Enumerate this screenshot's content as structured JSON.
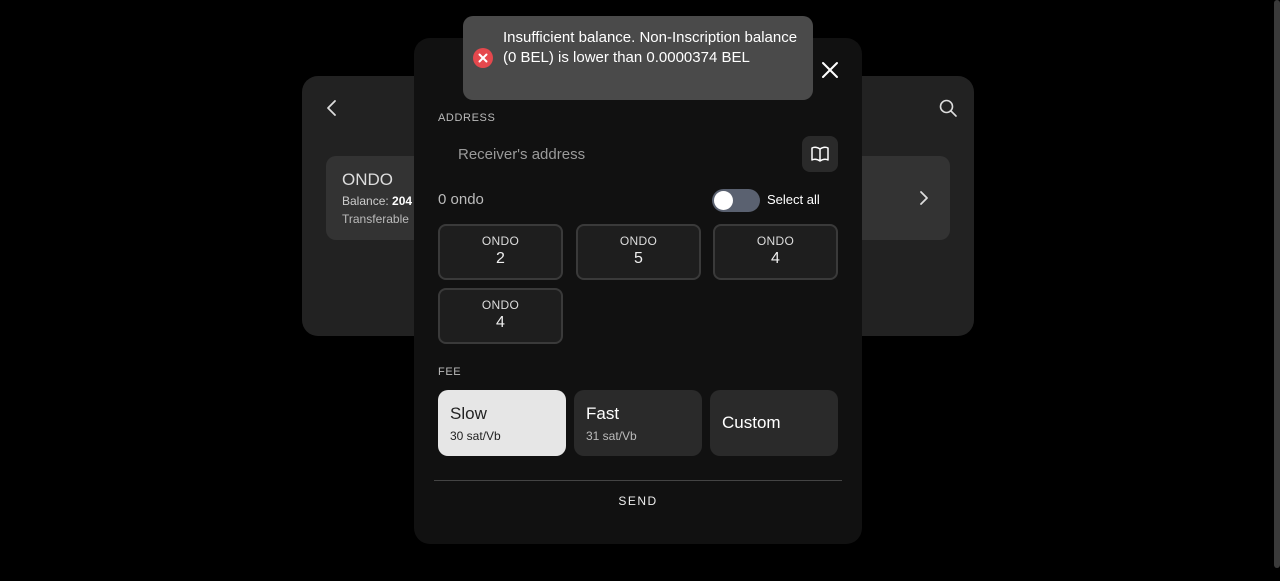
{
  "background": {
    "token": {
      "name": "ONDO",
      "balance_label": "Balance:",
      "balance_value": "204",
      "transferable_label": "Transferable"
    }
  },
  "modal": {
    "address_section_label": "ADDRESS",
    "address_placeholder": "Receiver's address",
    "selected_count": "0 ondo",
    "select_all_label": "Select all",
    "select_all_on": false,
    "inscriptions": [
      {
        "tick": "ONDO",
        "amount": "2"
      },
      {
        "tick": "ONDO",
        "amount": "5"
      },
      {
        "tick": "ONDO",
        "amount": "4"
      },
      {
        "tick": "ONDO",
        "amount": "4"
      }
    ],
    "fee_section_label": "FEE",
    "fees": [
      {
        "title": "Slow",
        "rate": "30 sat/Vb",
        "selected": true
      },
      {
        "title": "Fast",
        "rate": "31 sat/Vb",
        "selected": false
      },
      {
        "title": "Custom",
        "rate": "",
        "selected": false
      }
    ],
    "send_label": "SEND"
  },
  "toast": {
    "type": "error",
    "message": "Insufficient balance. Non-Inscription balance (0 BEL) is lower than 0.0000374 BEL"
  },
  "colors": {
    "error_red": "#e5484d",
    "selected_fee_bg": "#e6e6e6",
    "toast_bg": "#4a4a4a"
  }
}
